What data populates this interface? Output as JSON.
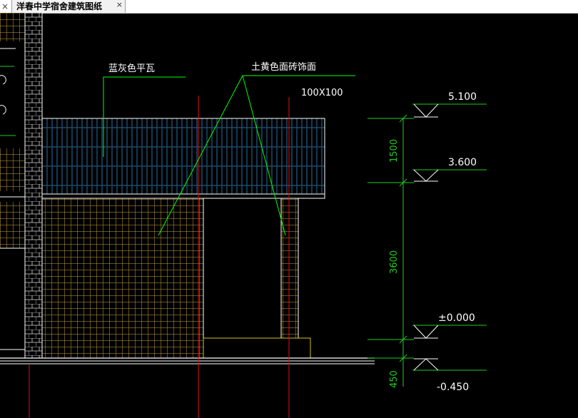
{
  "tab": {
    "title": "洋春中学宿舍建筑图纸",
    "close_glyph": "×",
    "left_close_glyph": "×"
  },
  "drawing": {
    "labels": {
      "roof_tile": "蓝灰色平瓦",
      "wall_tile": "土黄色面砖饰面",
      "tile_size": "100X100"
    },
    "elevations": {
      "top": "5.100",
      "eave": "3.600",
      "ground": "±0.000",
      "base": "-0.450"
    },
    "dimensions": {
      "roof_height": "1500",
      "wall_height": "3600",
      "base_height": "450"
    },
    "colors": {
      "background": "#000000",
      "leader": "#00ff00",
      "dimension": "#22cc22",
      "axis": "#e01010",
      "wall_grid": "#c8a040",
      "roof_tile": "#2a6fa0",
      "outline": "#ffffff"
    }
  }
}
